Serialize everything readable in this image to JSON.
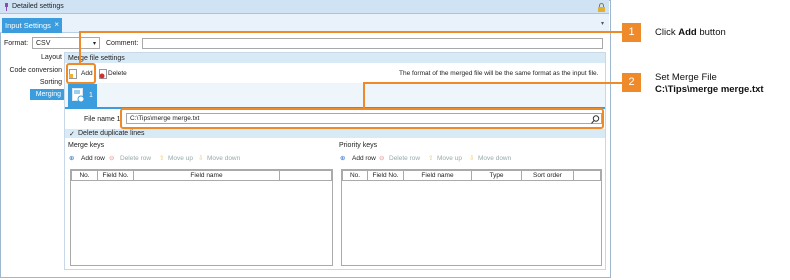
{
  "window": {
    "title": "Detailed settings"
  },
  "tab": {
    "label": "Input Settings",
    "close": "×"
  },
  "top": {
    "format_label": "Format:",
    "format_value": "CSV",
    "comment_label": "Comment:",
    "comment_value": ""
  },
  "nav": {
    "items": [
      "Layout",
      "Code conversion",
      "Sorting",
      "Merging"
    ],
    "selected": 3
  },
  "merge": {
    "section_title": "Merge file settings",
    "add_label": "Add",
    "delete_label": "Delete",
    "info_text": "The format of the merged file will be the same format as the input file.",
    "file_index": "1",
    "file_name_label": "File name 1:",
    "file_name_value": "C:\\Tips\\merge merge.txt",
    "dedupe_label": "Delete duplicate lines",
    "dedupe_check": "✓"
  },
  "merge_keys": {
    "title": "Merge keys",
    "add_row": "Add row",
    "delete_row": "Delete row",
    "move_up": "Move up",
    "move_down": "Move down",
    "columns": [
      "No.",
      "Field No.",
      "Field name"
    ]
  },
  "priority_keys": {
    "title": "Priority keys",
    "add_row": "Add row",
    "delete_row": "Delete row",
    "move_up": "Move up",
    "move_down": "Move down",
    "columns": [
      "No.",
      "Field No.",
      "Field name",
      "Type",
      "Sort order"
    ]
  },
  "callouts": [
    {
      "number": "1",
      "text_prefix": "Click ",
      "text_bold": "Add",
      "text_suffix": " button"
    },
    {
      "number": "2",
      "line1": "Set Merge File",
      "line2": "C:\\Tips\\merge merge.txt"
    }
  ],
  "colors": {
    "accent": "#3b9ddd",
    "callout": "#ef8a2a",
    "section": "#d9eaf7"
  }
}
